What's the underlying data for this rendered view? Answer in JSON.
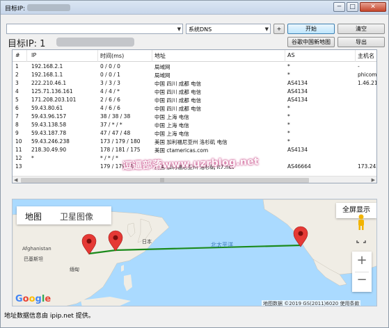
{
  "window": {
    "title": "目标IP:",
    "controls": {
      "minimize": "─",
      "maximize": "□",
      "close": "✕"
    }
  },
  "toolbar": {
    "host_value": "",
    "dns_value": "系统DNS",
    "plus_label": "+",
    "start_label": "开始",
    "clear_label": "清空",
    "map_label": "谷歌中国新地图",
    "export_label": "导出"
  },
  "target": {
    "label": "目标IP:  1"
  },
  "table": {
    "columns": [
      "#",
      "IP",
      "时间(ms)",
      "地址",
      "AS",
      "主机名"
    ],
    "rows": [
      {
        "no": "1",
        "ip": "192.168.2.1",
        "time": "0 / 0 / 0",
        "addr": "局域网",
        "as": "*",
        "host": "-"
      },
      {
        "no": "2",
        "ip": "192.168.1.1",
        "time": "0 / 0 / 1",
        "addr": "局域网",
        "as": "*",
        "host": "phicomm"
      },
      {
        "no": "3",
        "ip": "222.210.46.1",
        "time": "3 / 3 / 3",
        "addr": "中国 四川 成都 电信",
        "as": "AS4134",
        "host": "1.46.21"
      },
      {
        "no": "4",
        "ip": "125.71.136.161",
        "time": "4 / 4 / *",
        "addr": "中国 四川 成都 电信",
        "as": "AS4134",
        "host": ""
      },
      {
        "no": "5",
        "ip": "171.208.203.101",
        "time": "2 / 6 / 6",
        "addr": "中国 四川 成都 电信",
        "as": "AS4134",
        "host": ""
      },
      {
        "no": "6",
        "ip": "59.43.80.61",
        "time": "4 / 6 / 6",
        "addr": "中国 四川 成都 电信",
        "as": "*",
        "host": ""
      },
      {
        "no": "7",
        "ip": "59.43.96.157",
        "time": "38 / 38 / 38",
        "addr": "中国 上海 电信",
        "as": "*",
        "host": ""
      },
      {
        "no": "8",
        "ip": "59.43.138.58",
        "time": "37 / * / *",
        "addr": "中国 上海 电信",
        "as": "*",
        "host": ""
      },
      {
        "no": "9",
        "ip": "59.43.187.78",
        "time": "47 / 47 / 48",
        "addr": "中国 上海 电信",
        "as": "*",
        "host": ""
      },
      {
        "no": "10",
        "ip": "59.43.246.238",
        "time": "173 / 179 / 180",
        "addr": "美国 加利福尼亚州 洛杉矶 电信",
        "as": "*",
        "host": ""
      },
      {
        "no": "11",
        "ip": "218.30.49.90",
        "time": "178 / 181 / 175",
        "addr": "美国 ctamericas.com",
        "as": "AS4134",
        "host": ""
      },
      {
        "no": "12",
        "ip": "*",
        "time": "* / * / *",
        "addr": "",
        "as": "",
        "host": ""
      },
      {
        "no": "13",
        "ip": "",
        "time": "179 / 179 / 179",
        "addr": "美国 加利福尼亚州 洛杉矶 it7.net",
        "as": "AS46664",
        "host": "173.242"
      }
    ],
    "watermark": "逗逼部落www.uzrblog.net",
    "scroll_grip": "|||"
  },
  "map": {
    "tabs": [
      "地图",
      "卫星图像"
    ],
    "fullscreen_label": "全屏显示",
    "zoom_in": "+",
    "zoom_out": "−",
    "google_logo": "Google",
    "copyright": "地图数据 ©2019 GS(2011)6020  使用条款",
    "labels": {
      "ocean": "北太平洋",
      "japan": "日本",
      "afghanistan": "Afghanistan",
      "pakistan": "巴基斯坦",
      "myanmar": "缅甸"
    },
    "colors": {
      "water": "#aadaff",
      "land": "#f0ede5",
      "route": "#1b8a1b",
      "marker": "#e53935"
    }
  },
  "footer": {
    "text": "地址数据信息由 ipip.net 提供。"
  }
}
